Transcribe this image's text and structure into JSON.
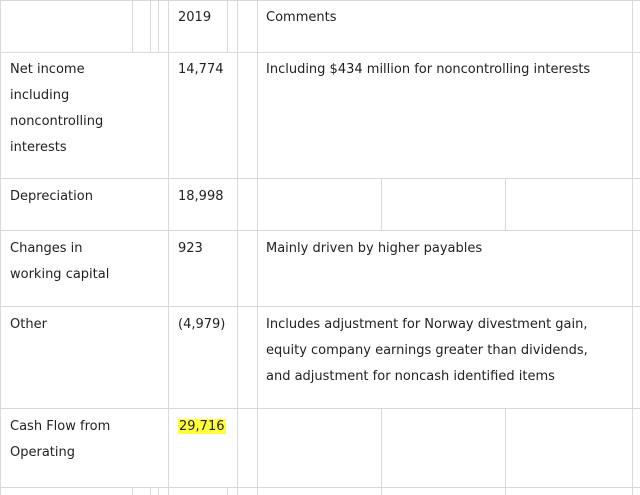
{
  "table": {
    "header": {
      "label": "",
      "year": "2019",
      "comments": "Comments"
    },
    "rows": [
      {
        "label_lines": [
          "Net income",
          "including",
          "noncontrolling",
          "interests"
        ],
        "value": "14,774",
        "comment_lines": [
          "Including $434 million for noncontrolling interests"
        ]
      },
      {
        "label_lines": [
          "Depreciation"
        ],
        "value": "18,998",
        "comment_lines": []
      },
      {
        "label_lines": [
          "Changes in",
          "working capital"
        ],
        "value": "923",
        "comment_lines": [
          "Mainly driven by higher payables"
        ]
      },
      {
        "label_lines": [
          "Other"
        ],
        "value": "(4,979)",
        "comment_lines": [
          "Includes adjustment for Norway divestment gain,",
          "equity company earnings greater than dividends,",
          "and adjustment for noncash identified items"
        ]
      },
      {
        "label_lines": [
          "Cash Flow from",
          "Operating"
        ],
        "value": "29,716",
        "value_highlighted": true,
        "comment_lines": []
      }
    ]
  },
  "colors": {
    "grid": "#d9d9d9",
    "highlight": "#ffff3a",
    "text": "#222222"
  }
}
